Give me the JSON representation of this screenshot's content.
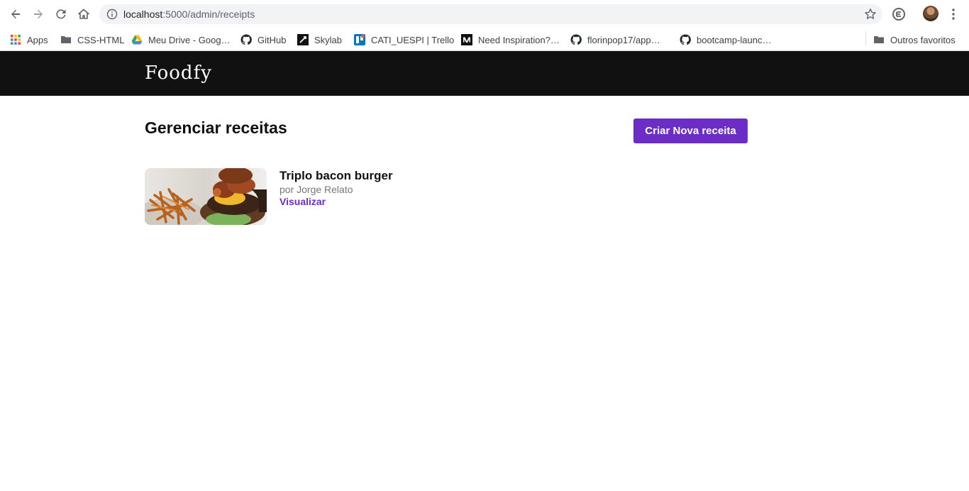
{
  "browser": {
    "url_host": "localhost",
    "url_path": ":5000/admin/receipts",
    "bookmarks": [
      {
        "label": "Apps",
        "icon": "apps-grid-icon"
      },
      {
        "label": "CSS-HTML",
        "icon": "folder-icon"
      },
      {
        "label": "Meu Drive - Goog…",
        "icon": "google-drive-icon"
      },
      {
        "label": "GitHub",
        "icon": "github-icon"
      },
      {
        "label": "Skylab",
        "icon": "skylab-icon"
      },
      {
        "label": "CATI_UESPI | Trello",
        "icon": "trello-icon"
      },
      {
        "label": "Need Inspiration?…",
        "icon": "medium-icon"
      },
      {
        "label": "florinpop17/app…",
        "icon": "github-icon"
      },
      {
        "label": "bootcamp-launc…",
        "icon": "github-icon"
      }
    ],
    "other_bookmarks": "Outros favoritos"
  },
  "site": {
    "logo": "Foodfy"
  },
  "main": {
    "title": "Gerenciar receitas",
    "create_button": "Criar Nova receita",
    "recipes": [
      {
        "title": "Triplo bacon burger",
        "author": "por Jorge Relato",
        "link": "Visualizar"
      }
    ]
  },
  "colors": {
    "accent": "#6c2dc7",
    "header_bg": "#111111"
  }
}
